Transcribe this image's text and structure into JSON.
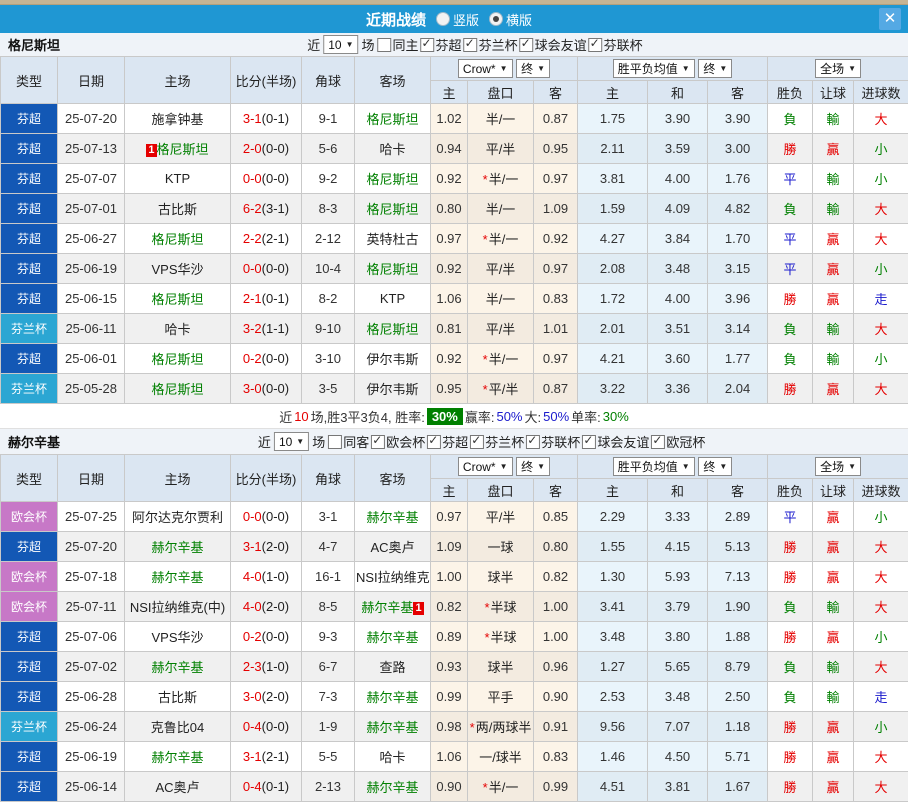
{
  "titlebar": {
    "title": "近期战绩",
    "close_icon": "✕",
    "options": [
      {
        "label": "竖版",
        "selected": false
      },
      {
        "label": "横版",
        "selected": true
      }
    ]
  },
  "colors": {
    "titlebar_bg": "#1f97d3",
    "type_fencao_blue": "#1358b5",
    "type_fenlanbei_cyan": "#2ba6d3",
    "type_ouhuibei_purple": "#c778c7",
    "header_bg": "#dbe6f2",
    "win_red": "#e50000",
    "lose_green": "#008000",
    "draw_blue": "#1a1acc",
    "odds_col_bg": "#fcf4e8",
    "avg_col_bg": "#e9f4fb",
    "summary_badge_bg": "#008000"
  },
  "sections": [
    {
      "team": "格尼斯坦",
      "filters": {
        "recent_label": "近",
        "count": "10",
        "match_label": "场",
        "same": {
          "label": "同主",
          "checked": false
        },
        "leagues": [
          {
            "label": "芬超",
            "checked": true
          },
          {
            "label": "芬兰杯",
            "checked": true
          },
          {
            "label": "球会友谊",
            "checked": true
          },
          {
            "label": "芬联杯",
            "checked": true
          }
        ]
      },
      "header": {
        "type": "类型",
        "date": "日期",
        "home": "主场",
        "score": "比分(半场)",
        "corner": "角球",
        "away": "客场",
        "odds_provider": "Crow*",
        "odds_final": "终",
        "avg_label": "胜平负均值",
        "avg_final": "终",
        "scope": "全场",
        "sub": [
          "主",
          "盘口",
          "客",
          "主",
          "和",
          "客",
          "胜负",
          "让球",
          "进球数"
        ]
      },
      "rows": [
        {
          "type": "芬超",
          "tkey": "su",
          "date": "25-07-20",
          "home": "施拿钟基",
          "home_green": false,
          "home_badge": "",
          "home_badge_pos": "",
          "score": "3-1",
          "half": "(0-1)",
          "corner": "9-1",
          "away": "格尼斯坦",
          "away_green": true,
          "away_badge": "",
          "away_badge_pos": "",
          "o_home": "1.02",
          "handicap": "半/一",
          "o_away": "0.87",
          "avg_home": "1.75",
          "avg_draw": "3.90",
          "avg_away": "3.90",
          "res": "負",
          "let": "輸",
          "goal": "大"
        },
        {
          "type": "芬超",
          "tkey": "su",
          "date": "25-07-13",
          "home": "格尼斯坦",
          "home_green": true,
          "home_badge": "1",
          "home_badge_pos": "before",
          "score": "2-0",
          "half": "(0-0)",
          "corner": "5-6",
          "away": "哈卡",
          "away_green": false,
          "away_badge": "",
          "away_badge_pos": "",
          "o_home": "0.94",
          "handicap": "平/半",
          "o_away": "0.95",
          "avg_home": "2.11",
          "avg_draw": "3.59",
          "avg_away": "3.00",
          "res": "勝",
          "let": "贏",
          "goal": "小"
        },
        {
          "type": "芬超",
          "tkey": "su",
          "date": "25-07-07",
          "home": "KTP",
          "home_green": false,
          "home_badge": "",
          "home_badge_pos": "",
          "score": "0-0",
          "half": "(0-0)",
          "corner": "9-2",
          "away": "格尼斯坦",
          "away_green": true,
          "away_badge": "",
          "away_badge_pos": "",
          "o_home": "0.92",
          "handicap": "*半/一",
          "o_away": "0.97",
          "avg_home": "3.81",
          "avg_draw": "4.00",
          "avg_away": "1.76",
          "res": "平",
          "let": "輸",
          "goal": "小"
        },
        {
          "type": "芬超",
          "tkey": "su",
          "date": "25-07-01",
          "home": "古比斯",
          "home_green": false,
          "home_badge": "",
          "home_badge_pos": "",
          "score": "6-2",
          "half": "(3-1)",
          "corner": "8-3",
          "away": "格尼斯坦",
          "away_green": true,
          "away_badge": "",
          "away_badge_pos": "",
          "o_home": "0.80",
          "handicap": "半/一",
          "o_away": "1.09",
          "avg_home": "1.59",
          "avg_draw": "4.09",
          "avg_away": "4.82",
          "res": "負",
          "let": "輸",
          "goal": "大"
        },
        {
          "type": "芬超",
          "tkey": "su",
          "date": "25-06-27",
          "home": "格尼斯坦",
          "home_green": true,
          "home_badge": "",
          "home_badge_pos": "",
          "score": "2-2",
          "half": "(2-1)",
          "corner": "2-12",
          "away": "英特杜古",
          "away_green": false,
          "away_badge": "",
          "away_badge_pos": "",
          "o_home": "0.97",
          "handicap": "*半/一",
          "o_away": "0.92",
          "avg_home": "4.27",
          "avg_draw": "3.84",
          "avg_away": "1.70",
          "res": "平",
          "let": "贏",
          "goal": "大"
        },
        {
          "type": "芬超",
          "tkey": "su",
          "date": "25-06-19",
          "home": "VPS华沙",
          "home_green": false,
          "home_badge": "",
          "home_badge_pos": "",
          "score": "0-0",
          "half": "(0-0)",
          "corner": "10-4",
          "away": "格尼斯坦",
          "away_green": true,
          "away_badge": "",
          "away_badge_pos": "",
          "o_home": "0.92",
          "handicap": "平/半",
          "o_away": "0.97",
          "avg_home": "2.08",
          "avg_draw": "3.48",
          "avg_away": "3.15",
          "res": "平",
          "let": "贏",
          "goal": "小"
        },
        {
          "type": "芬超",
          "tkey": "su",
          "date": "25-06-15",
          "home": "格尼斯坦",
          "home_green": true,
          "home_badge": "",
          "home_badge_pos": "",
          "score": "2-1",
          "half": "(0-1)",
          "corner": "8-2",
          "away": "KTP",
          "away_green": false,
          "away_badge": "",
          "away_badge_pos": "",
          "o_home": "1.06",
          "handicap": "半/一",
          "o_away": "0.83",
          "avg_home": "1.72",
          "avg_draw": "4.00",
          "avg_away": "3.96",
          "res": "勝",
          "let": "贏",
          "goal": "走"
        },
        {
          "type": "芬兰杯",
          "tkey": "cup",
          "date": "25-06-11",
          "home": "哈卡",
          "home_green": false,
          "home_badge": "",
          "home_badge_pos": "",
          "score": "3-2",
          "half": "(1-1)",
          "corner": "9-10",
          "away": "格尼斯坦",
          "away_green": true,
          "away_badge": "",
          "away_badge_pos": "",
          "o_home": "0.81",
          "handicap": "平/半",
          "o_away": "1.01",
          "avg_home": "2.01",
          "avg_draw": "3.51",
          "avg_away": "3.14",
          "res": "負",
          "let": "輸",
          "goal": "大"
        },
        {
          "type": "芬超",
          "tkey": "su",
          "date": "25-06-01",
          "home": "格尼斯坦",
          "home_green": true,
          "home_badge": "",
          "home_badge_pos": "",
          "score": "0-2",
          "half": "(0-0)",
          "corner": "3-10",
          "away": "伊尔韦斯",
          "away_green": false,
          "away_badge": "",
          "away_badge_pos": "",
          "o_home": "0.92",
          "handicap": "*半/一",
          "o_away": "0.97",
          "avg_home": "4.21",
          "avg_draw": "3.60",
          "avg_away": "1.77",
          "res": "負",
          "let": "輸",
          "goal": "小"
        },
        {
          "type": "芬兰杯",
          "tkey": "cup",
          "date": "25-05-28",
          "home": "格尼斯坦",
          "home_green": true,
          "home_badge": "",
          "home_badge_pos": "",
          "score": "3-0",
          "half": "(0-0)",
          "corner": "3-5",
          "away": "伊尔韦斯",
          "away_green": false,
          "away_badge": "",
          "away_badge_pos": "",
          "o_home": "0.95",
          "handicap": "*平/半",
          "o_away": "0.87",
          "avg_home": "3.22",
          "avg_draw": "3.36",
          "avg_away": "2.04",
          "res": "勝",
          "let": "贏",
          "goal": "大"
        }
      ],
      "summary": [
        {
          "text": "近",
          "color": "#333333"
        },
        {
          "text": "10",
          "color": "#e50000"
        },
        {
          "text": "场,胜3平3负4, 胜率:",
          "color": "#333333"
        },
        {
          "text": "30%",
          "badge": true
        },
        {
          "text": " 赢率:",
          "color": "#333333"
        },
        {
          "text": "50%",
          "color": "#1a1acc"
        },
        {
          "text": " 大:",
          "color": "#333333"
        },
        {
          "text": "50%",
          "color": "#1a1acc"
        },
        {
          "text": " 单率:",
          "color": "#333333"
        },
        {
          "text": "30%",
          "color": "#008000"
        }
      ]
    },
    {
      "team": "赫尔辛基",
      "filters": {
        "recent_label": "近",
        "count": "10",
        "match_label": "场",
        "same": {
          "label": "同客",
          "checked": false
        },
        "leagues": [
          {
            "label": "欧会杯",
            "checked": true
          },
          {
            "label": "芬超",
            "checked": true
          },
          {
            "label": "芬兰杯",
            "checked": true
          },
          {
            "label": "芬联杯",
            "checked": true
          },
          {
            "label": "球会友谊",
            "checked": true
          },
          {
            "label": "欧冠杯",
            "checked": true
          }
        ]
      },
      "header": {
        "type": "类型",
        "date": "日期",
        "home": "主场",
        "score": "比分(半场)",
        "corner": "角球",
        "away": "客场",
        "odds_provider": "Crow*",
        "odds_final": "终",
        "avg_label": "胜平负均值",
        "avg_final": "终",
        "scope": "全场",
        "sub": [
          "主",
          "盘口",
          "客",
          "主",
          "和",
          "客",
          "胜负",
          "让球",
          "进球数"
        ]
      },
      "rows": [
        {
          "type": "欧会杯",
          "tkey": "eu",
          "date": "25-07-25",
          "home": "阿尔达克尔贾利",
          "home_green": false,
          "home_badge": "",
          "home_badge_pos": "",
          "score": "0-0",
          "half": "(0-0)",
          "corner": "3-1",
          "away": "赫尔辛基",
          "away_green": true,
          "away_badge": "",
          "away_badge_pos": "",
          "o_home": "0.97",
          "handicap": "平/半",
          "o_away": "0.85",
          "avg_home": "2.29",
          "avg_draw": "3.33",
          "avg_away": "2.89",
          "res": "平",
          "let": "贏",
          "goal": "小"
        },
        {
          "type": "芬超",
          "tkey": "su",
          "date": "25-07-20",
          "home": "赫尔辛基",
          "home_green": true,
          "home_badge": "",
          "home_badge_pos": "",
          "score": "3-1",
          "half": "(2-0)",
          "corner": "4-7",
          "away": "AC奥卢",
          "away_green": false,
          "away_badge": "",
          "away_badge_pos": "",
          "o_home": "1.09",
          "handicap": "一球",
          "o_away": "0.80",
          "avg_home": "1.55",
          "avg_draw": "4.15",
          "avg_away": "5.13",
          "res": "勝",
          "let": "贏",
          "goal": "大"
        },
        {
          "type": "欧会杯",
          "tkey": "eu",
          "date": "25-07-18",
          "home": "赫尔辛基",
          "home_green": true,
          "home_badge": "",
          "home_badge_pos": "",
          "score": "4-0",
          "half": "(1-0)",
          "corner": "16-1",
          "away": "NSI拉纳维克",
          "away_green": false,
          "away_badge": "1",
          "away_badge_pos": "after",
          "o_home": "1.00",
          "handicap": "球半",
          "o_away": "0.82",
          "avg_home": "1.30",
          "avg_draw": "5.93",
          "avg_away": "7.13",
          "res": "勝",
          "let": "贏",
          "goal": "大"
        },
        {
          "type": "欧会杯",
          "tkey": "eu",
          "date": "25-07-11",
          "home": "NSI拉纳维克(中)",
          "home_green": false,
          "home_badge": "",
          "home_badge_pos": "",
          "score": "4-0",
          "half": "(2-0)",
          "corner": "8-5",
          "away": "赫尔辛基",
          "away_green": true,
          "away_badge": "1",
          "away_badge_pos": "after",
          "o_home": "0.82",
          "handicap": "*半球",
          "o_away": "1.00",
          "avg_home": "3.41",
          "avg_draw": "3.79",
          "avg_away": "1.90",
          "res": "負",
          "let": "輸",
          "goal": "大"
        },
        {
          "type": "芬超",
          "tkey": "su",
          "date": "25-07-06",
          "home": "VPS华沙",
          "home_green": false,
          "home_badge": "",
          "home_badge_pos": "",
          "score": "0-2",
          "half": "(0-0)",
          "corner": "9-3",
          "away": "赫尔辛基",
          "away_green": true,
          "away_badge": "",
          "away_badge_pos": "",
          "o_home": "0.89",
          "handicap": "*半球",
          "o_away": "1.00",
          "avg_home": "3.48",
          "avg_draw": "3.80",
          "avg_away": "1.88",
          "res": "勝",
          "let": "贏",
          "goal": "小"
        },
        {
          "type": "芬超",
          "tkey": "su",
          "date": "25-07-02",
          "home": "赫尔辛基",
          "home_green": true,
          "home_badge": "",
          "home_badge_pos": "",
          "score": "2-3",
          "half": "(1-0)",
          "corner": "6-7",
          "away": "查路",
          "away_green": false,
          "away_badge": "",
          "away_badge_pos": "",
          "o_home": "0.93",
          "handicap": "球半",
          "o_away": "0.96",
          "avg_home": "1.27",
          "avg_draw": "5.65",
          "avg_away": "8.79",
          "res": "負",
          "let": "輸",
          "goal": "大"
        },
        {
          "type": "芬超",
          "tkey": "su",
          "date": "25-06-28",
          "home": "古比斯",
          "home_green": false,
          "home_badge": "",
          "home_badge_pos": "",
          "score": "3-0",
          "half": "(2-0)",
          "corner": "7-3",
          "away": "赫尔辛基",
          "away_green": true,
          "away_badge": "",
          "away_badge_pos": "",
          "o_home": "0.99",
          "handicap": "平手",
          "o_away": "0.90",
          "avg_home": "2.53",
          "avg_draw": "3.48",
          "avg_away": "2.50",
          "res": "負",
          "let": "輸",
          "goal": "走"
        },
        {
          "type": "芬兰杯",
          "tkey": "cup",
          "date": "25-06-24",
          "home": "克鲁比04",
          "home_green": false,
          "home_badge": "",
          "home_badge_pos": "",
          "score": "0-4",
          "half": "(0-0)",
          "corner": "1-9",
          "away": "赫尔辛基",
          "away_green": true,
          "away_badge": "",
          "away_badge_pos": "",
          "o_home": "0.98",
          "handicap": "*两/两球半",
          "o_away": "0.91",
          "avg_home": "9.56",
          "avg_draw": "7.07",
          "avg_away": "1.18",
          "res": "勝",
          "let": "贏",
          "goal": "小"
        },
        {
          "type": "芬超",
          "tkey": "su",
          "date": "25-06-19",
          "home": "赫尔辛基",
          "home_green": true,
          "home_badge": "",
          "home_badge_pos": "",
          "score": "3-1",
          "half": "(2-1)",
          "corner": "5-5",
          "away": "哈卡",
          "away_green": false,
          "away_badge": "",
          "away_badge_pos": "",
          "o_home": "1.06",
          "handicap": "一/球半",
          "o_away": "0.83",
          "avg_home": "1.46",
          "avg_draw": "4.50",
          "avg_away": "5.71",
          "res": "勝",
          "let": "贏",
          "goal": "大"
        },
        {
          "type": "芬超",
          "tkey": "su",
          "date": "25-06-14",
          "home": "AC奥卢",
          "home_green": false,
          "home_badge": "",
          "home_badge_pos": "",
          "score": "0-4",
          "half": "(0-1)",
          "corner": "2-13",
          "away": "赫尔辛基",
          "away_green": true,
          "away_badge": "",
          "away_badge_pos": "",
          "o_home": "0.90",
          "handicap": "*半/一",
          "o_away": "0.99",
          "avg_home": "4.51",
          "avg_draw": "3.81",
          "avg_away": "1.67",
          "res": "勝",
          "let": "贏",
          "goal": "大"
        }
      ],
      "summary": null
    }
  ]
}
